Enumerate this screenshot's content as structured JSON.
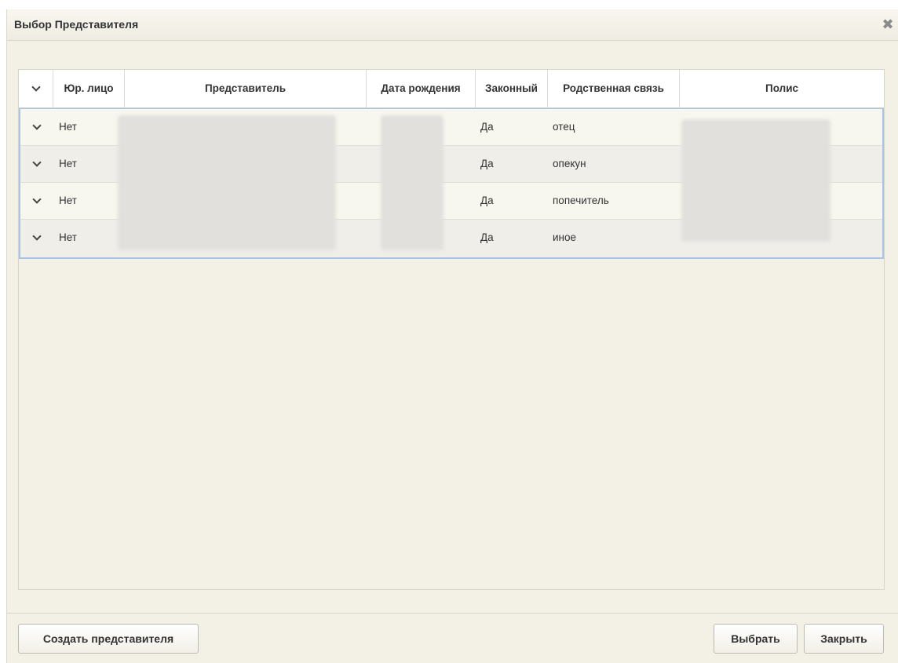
{
  "dialog": {
    "title": "Выбор Представителя",
    "close_icon": "close-icon"
  },
  "table": {
    "columns": [
      "Юр. лицо",
      "Представитель",
      "Дата рождения",
      "Законный",
      "Родственная связь",
      "Полис"
    ],
    "rows": [
      {
        "legal_entity": "Нет",
        "legal": "Да",
        "relation": "отец"
      },
      {
        "legal_entity": "Нет",
        "legal": "Да",
        "relation": "опекун"
      },
      {
        "legal_entity": "Нет",
        "legal": "Да",
        "relation": "попечитель"
      },
      {
        "legal_entity": "Нет",
        "legal": "Да",
        "relation": "иное"
      }
    ]
  },
  "footer": {
    "create_label": "Создать представителя",
    "select_label": "Выбрать",
    "close_label": "Закрыть"
  }
}
